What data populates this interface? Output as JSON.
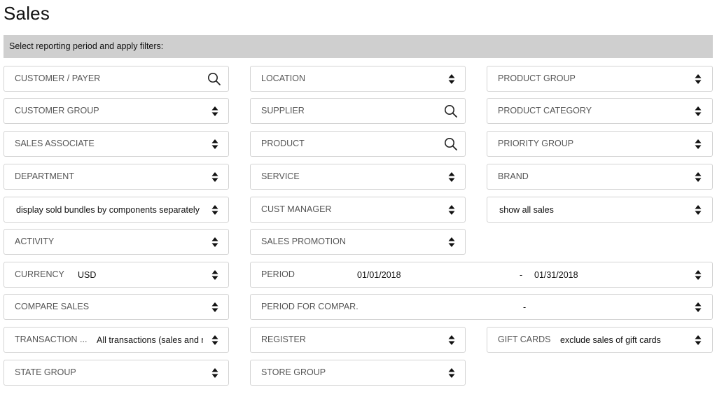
{
  "page": {
    "title": "Sales"
  },
  "filter_bar": {
    "instruction": "Select reporting period and apply filters:"
  },
  "fields": {
    "customer_payer": {
      "label": "CUSTOMER / PAYER",
      "icon": "search-icon"
    },
    "location": {
      "label": "LOCATION",
      "icon": "sort-icon"
    },
    "product_group": {
      "label": "PRODUCT GROUP",
      "icon": "sort-icon"
    },
    "customer_group": {
      "label": "CUSTOMER GROUP",
      "icon": "sort-icon"
    },
    "supplier": {
      "label": "SUPPLIER",
      "icon": "search-icon"
    },
    "product_category": {
      "label": "PRODUCT CATEGORY",
      "icon": "sort-icon"
    },
    "sales_associate": {
      "label": "SALES ASSOCIATE",
      "icon": "sort-icon"
    },
    "product": {
      "label": "PRODUCT",
      "icon": "search-icon"
    },
    "priority_group": {
      "label": "PRIORITY GROUP",
      "icon": "sort-icon"
    },
    "department": {
      "label": "DEPARTMENT",
      "icon": "sort-icon"
    },
    "service": {
      "label": "SERVICE",
      "icon": "sort-icon"
    },
    "brand": {
      "label": "BRAND",
      "icon": "sort-icon"
    },
    "bundles": {
      "value": "display sold bundles by components separately",
      "icon": "sort-icon"
    },
    "cust_manager": {
      "label": "CUST MANAGER",
      "icon": "sort-icon"
    },
    "sales_display": {
      "value": "show all sales",
      "icon": "sort-icon"
    },
    "activity": {
      "label": "ACTIVITY",
      "icon": "sort-icon"
    },
    "sales_promotion": {
      "label": "SALES PROMOTION",
      "icon": "sort-icon"
    },
    "currency": {
      "label": "CURRENCY",
      "value": "USD",
      "icon": "sort-icon"
    },
    "period": {
      "label": "PERIOD",
      "start": "01/01/2018",
      "separator": "-",
      "end": "01/31/2018",
      "icon": "sort-icon"
    },
    "compare_sales": {
      "label": "COMPARE SALES",
      "icon": "sort-icon"
    },
    "period_compare": {
      "label": "PERIOD FOR COMPAR.",
      "separator": "-",
      "icon": "sort-icon"
    },
    "transaction_type": {
      "label": "TRANSACTION ...",
      "value": "All transactions (sales and r",
      "icon": "sort-icon"
    },
    "register": {
      "label": "REGISTER",
      "icon": "sort-icon"
    },
    "gift_cards": {
      "label": "GIFT CARDS",
      "value": "exclude sales of gift cards",
      "icon": "sort-icon"
    },
    "state_group": {
      "label": "STATE GROUP",
      "icon": "sort-icon"
    },
    "store_group": {
      "label": "STORE GROUP",
      "icon": "sort-icon"
    }
  }
}
